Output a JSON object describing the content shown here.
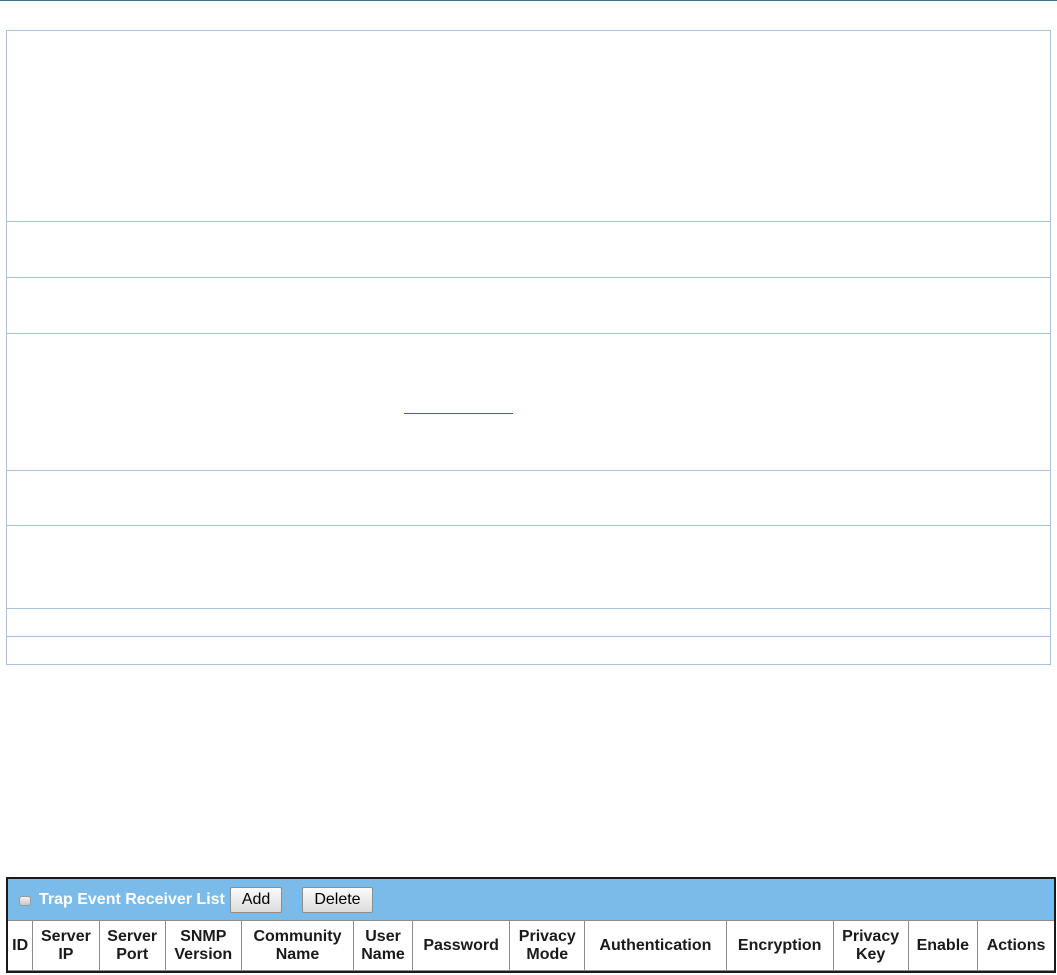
{
  "trap_list": {
    "title": "Trap Event Receiver List",
    "add_label": "Add",
    "delete_label": "Delete",
    "header_color": "#7bbbea",
    "icon": "toggle-icon",
    "columns": [
      {
        "line1": "ID",
        "line2": ""
      },
      {
        "line1": "Server",
        "line2": "IP"
      },
      {
        "line1": "Server",
        "line2": "Port"
      },
      {
        "line1": "SNMP",
        "line2": "Version"
      },
      {
        "line1": "Community",
        "line2": "Name"
      },
      {
        "line1": "User",
        "line2": "Name"
      },
      {
        "line1": "Password",
        "line2": ""
      },
      {
        "line1": "Privacy",
        "line2": "Mode"
      },
      {
        "line1": "Authentication",
        "line2": ""
      },
      {
        "line1": "Encryption",
        "line2": ""
      },
      {
        "line1": "Privacy",
        "line2": "Key"
      },
      {
        "line1": "Enable",
        "line2": ""
      },
      {
        "line1": "Actions",
        "line2": ""
      }
    ]
  }
}
